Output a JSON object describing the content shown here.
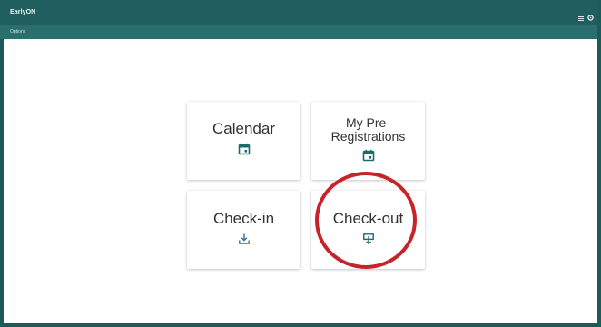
{
  "window": {
    "title": "EarlyON"
  },
  "menubar": {
    "options_label": "Options"
  },
  "tiles": [
    {
      "label": "Calendar",
      "icon": "calendar-icon"
    },
    {
      "label": "My Pre-\nRegistrations",
      "icon": "calendar-icon"
    },
    {
      "label": "Check-in",
      "icon": "download-tray-icon"
    },
    {
      "label": "Check-out",
      "icon": "download-box-icon"
    }
  ],
  "colors": {
    "chrome": "#1f5f5f",
    "accent": "#1d6c6c",
    "annotation": "#c8222a"
  }
}
